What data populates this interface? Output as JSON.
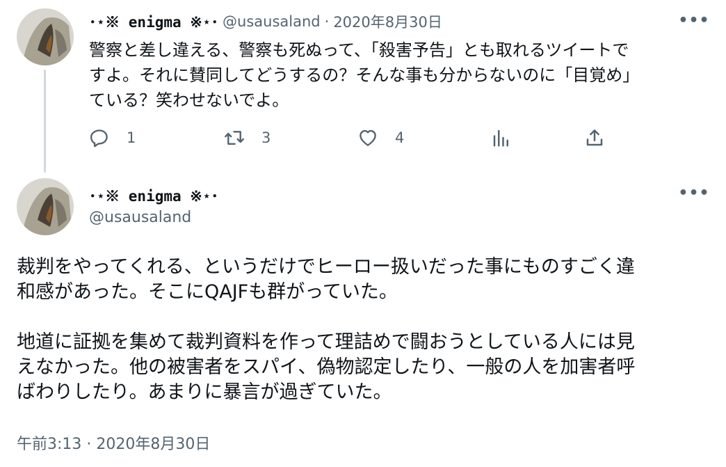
{
  "reply": {
    "display_name": "･⋆※ enigma ※⋆･",
    "handle": "@usausaland",
    "separator": "·",
    "date": "2020年8月30日",
    "more": "•••",
    "lines": [
      "警察と差し違える、警察も死ぬって、「殺害予告」とも取れるツイートで",
      "すよ。それに賛同してどうするの？そんな事も分からないのに「目覚め」",
      "ている？笑わせないでよ。"
    ],
    "actions": {
      "reply_count": "1",
      "retweet_count": "3",
      "like_count": "4"
    },
    "icons": [
      "reply-icon",
      "retweet-icon",
      "like-icon",
      "analytics-icon",
      "share-icon"
    ]
  },
  "main_tweet": {
    "display_name": "･⋆※ enigma ※⋆･",
    "handle": "@usausaland",
    "more": "•••",
    "paragraph1": [
      "裁判をやってくれる、というだけでヒーロー扱いだった事にものすごく違",
      "和感があった。そこにQAJFも群がっていた。"
    ],
    "paragraph2": [
      "地道に証拠を集めて裁判資料を作って理詰めで闘おうとしている人には見",
      "えなかった。他の被害者をスパイ、偽物認定したり、一般の人を加害者呼",
      "ばわりしたり。あまりに暴言が過ぎていた。"
    ],
    "timestamp": "午前3:13 · 2020年8月30日"
  },
  "colors": {
    "text": "#0f1419",
    "secondary": "#536471",
    "thread_line": "#cfd9de"
  }
}
